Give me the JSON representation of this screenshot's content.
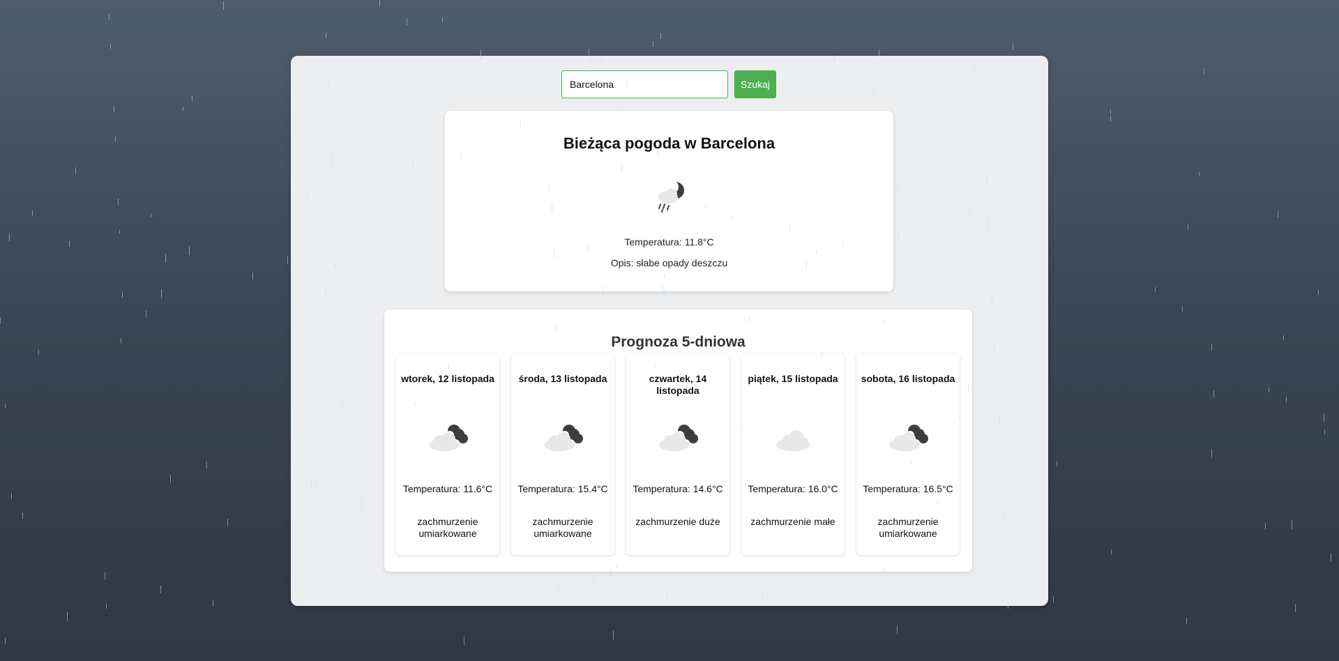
{
  "search": {
    "value": "Barcelona",
    "button_label": "Szukaj"
  },
  "current": {
    "title": "Bieżąca pogoda w Barcelona",
    "icon": "cloud-rain-moon-icon",
    "temperature": "Temperatura: 11.8°C",
    "description": "Opis: słabe opady deszczu"
  },
  "forecast": {
    "title": "Prognoza 5-dniowa",
    "days": [
      {
        "date": "wtorek, 12 listopada",
        "icon": "cloud-moon-icon",
        "temperature": "Temperatura: 11.6°C",
        "description": "zachmurzenie umiarkowane"
      },
      {
        "date": "środa, 13 listopada",
        "icon": "cloud-moon-icon",
        "temperature": "Temperatura: 15.4°C",
        "description": "zachmurzenie umiarkowane"
      },
      {
        "date": "czwartek, 14 listopada",
        "icon": "cloud-moon-icon",
        "temperature": "Temperatura: 14.6°C",
        "description": "zachmurzenie duże"
      },
      {
        "date": "piątek, 15 listopada",
        "icon": "cloud-icon",
        "temperature": "Temperatura: 16.0°C",
        "description": "zachmurzenie małe"
      },
      {
        "date": "sobota, 16 listopada",
        "icon": "cloud-moon-icon",
        "temperature": "Temperatura: 16.5°C",
        "description": "zachmurzenie umiarkowane"
      }
    ]
  },
  "colors": {
    "accent": "#4caf50",
    "background_top": "#4e5d6d",
    "background_bottom": "#2f3843",
    "rain": "#b4e1eb"
  }
}
